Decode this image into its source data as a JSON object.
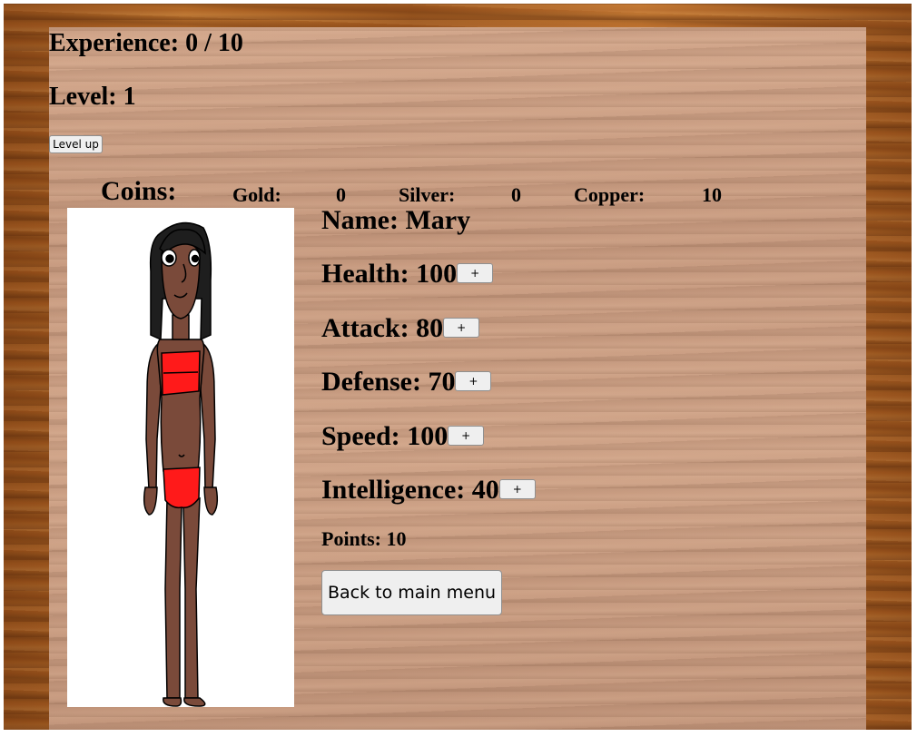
{
  "experience": {
    "label": "Experience:",
    "current": "0",
    "sep": "/",
    "max": "10"
  },
  "level": {
    "label": "Level:",
    "value": "1"
  },
  "level_up_button": "Level up",
  "coins": {
    "heading": "Coins:",
    "gold": {
      "label": "Gold:",
      "value": "0"
    },
    "silver": {
      "label": "Silver:",
      "value": "0"
    },
    "copper": {
      "label": "Copper:",
      "value": "10"
    }
  },
  "character": {
    "name_label": "Name:",
    "name": "Mary",
    "stats": [
      {
        "label": "Health:",
        "value": "100"
      },
      {
        "label": "Attack:",
        "value": "80"
      },
      {
        "label": "Defense:",
        "value": "70"
      },
      {
        "label": "Speed:",
        "value": "100"
      },
      {
        "label": "Intelligence:",
        "value": "40"
      }
    ],
    "increase_label": "+",
    "points_label": "Points:",
    "points": "10"
  },
  "back_button": "Back to main menu",
  "colors": {
    "skin": "#7a4a3a",
    "outfit": "#ff1a1a",
    "hair": "#1a1a1a"
  }
}
